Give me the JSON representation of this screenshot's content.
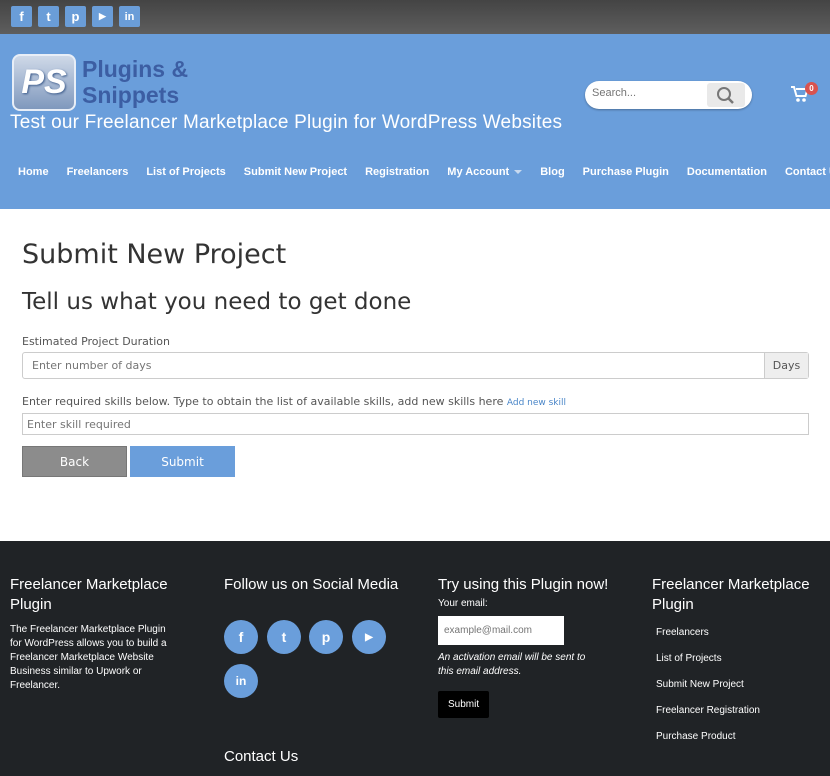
{
  "topbar": {
    "social": [
      {
        "icon": "facebook-icon",
        "glyph": "f"
      },
      {
        "icon": "twitter-icon",
        "glyph": "t"
      },
      {
        "icon": "pinterest-icon",
        "glyph": "p"
      },
      {
        "icon": "youtube-icon",
        "glyph": "▶"
      },
      {
        "icon": "linkedin-icon",
        "glyph": "in"
      }
    ]
  },
  "header": {
    "logo_mark": "PS",
    "logo_line1": "Plugins &",
    "logo_line2": "Snippets",
    "tagline": "Test our Freelancer Marketplace Plugin for WordPress Websites",
    "search_placeholder": "Search...",
    "cart_count": "0"
  },
  "nav": [
    "Home",
    "Freelancers",
    "List of Projects",
    "Submit New Project",
    "Registration",
    "My Account",
    "Blog",
    "Purchase Plugin",
    "Documentation",
    "Contact Us"
  ],
  "main": {
    "title": "Submit New Project",
    "subtitle": "Tell us what you need to get done",
    "duration_label": "Estimated Project Duration",
    "duration_placeholder": "Enter number of days",
    "duration_addon": "Days",
    "skills_label": "Enter required skills below. Type to obtain the list of available skills, add new skills here",
    "add_skill_link": "Add new skill",
    "skill_placeholder": "Enter skill required",
    "back_label": "Back",
    "submit_label": "Submit"
  },
  "footer": {
    "col1_title": "Freelancer Marketplace Plugin",
    "col1_text": "The Freelancer Marketplace Plugin for WordPress allows you to build a Freelancer Marketplace Website Business similar to Upwork or Freelancer.",
    "col2_title": "Follow us on Social Media",
    "contact_title": "Contact Us",
    "col3_title": "Try using this Plugin now!",
    "email_label": "Your email:",
    "email_placeholder": "example@mail.com",
    "email_note": "An activation email will be sent to this email address.",
    "email_button": "Submit",
    "col4_title": "Freelancer Marketplace Plugin",
    "links": [
      "Freelancers",
      "List of Projects",
      "Submit New Project",
      "Freelancer Registration",
      "Purchase Product"
    ]
  },
  "colors": {
    "accent": "#6a9edb",
    "footer_bg": "#202326",
    "topbar_bg": "#555555",
    "logo_text": "#3c5ea3"
  }
}
